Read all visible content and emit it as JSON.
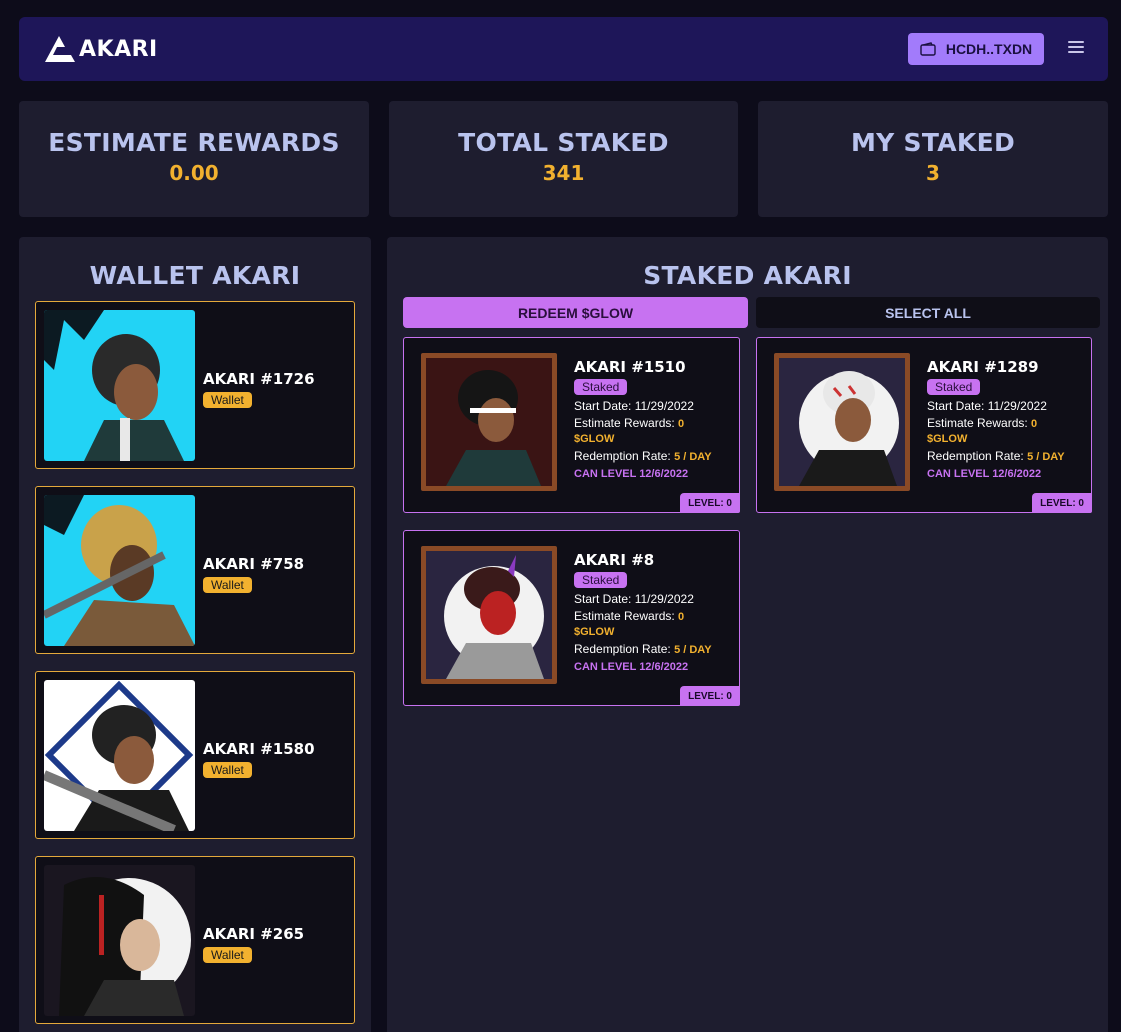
{
  "header": {
    "logo_text": "AKARI",
    "wallet_button_label": "HCDH..TXDN",
    "menu_icon": "hamburger-menu-icon"
  },
  "stats": [
    {
      "label": "ESTIMATE REWARDS",
      "value": "0.00"
    },
    {
      "label": "TOTAL STAKED",
      "value": "341"
    },
    {
      "label": "MY STAKED",
      "value": "3"
    }
  ],
  "wallet_panel": {
    "title": "WALLET AKARI",
    "items": [
      {
        "name": "AKARI #1726",
        "badge": "Wallet"
      },
      {
        "name": "AKARI #758",
        "badge": "Wallet"
      },
      {
        "name": "AKARI #1580",
        "badge": "Wallet"
      },
      {
        "name": "AKARI #265",
        "badge": "Wallet"
      }
    ]
  },
  "staked_panel": {
    "title": "STAKED AKARI",
    "redeem_label": "REDEEM $GLOW",
    "select_all_label": "SELECT ALL",
    "start_date_label": "Start Date:",
    "estimate_rewards_label": "Estimate Rewards:",
    "redemption_rate_label": "Redemption Rate:",
    "items": [
      {
        "name": "AKARI #1510",
        "badge": "Staked",
        "start_date": "11/29/2022",
        "rewards": "0",
        "token": "$GLOW",
        "rate": "5 / DAY",
        "can_level": "CAN LEVEL 12/6/2022",
        "level": "LEVEL: 0"
      },
      {
        "name": "AKARI #1289",
        "badge": "Staked",
        "start_date": "11/29/2022",
        "rewards": "0",
        "token": "$GLOW",
        "rate": "5 / DAY",
        "can_level": "CAN LEVEL 12/6/2022",
        "level": "LEVEL: 0"
      },
      {
        "name": "AKARI #8",
        "badge": "Staked",
        "start_date": "11/29/2022",
        "rewards": "0",
        "token": "$GLOW",
        "rate": "5 / DAY",
        "can_level": "CAN LEVEL 12/6/2022",
        "level": "LEVEL: 0"
      }
    ]
  },
  "colors": {
    "background": "#0d0c1a",
    "topbar": "#1e1659",
    "panel": "#1e1d2f",
    "accent_gold": "#f2b12f",
    "accent_purple": "#c772f1",
    "wallet_button": "#a27bfb",
    "title_text": "#b9c3ee"
  }
}
